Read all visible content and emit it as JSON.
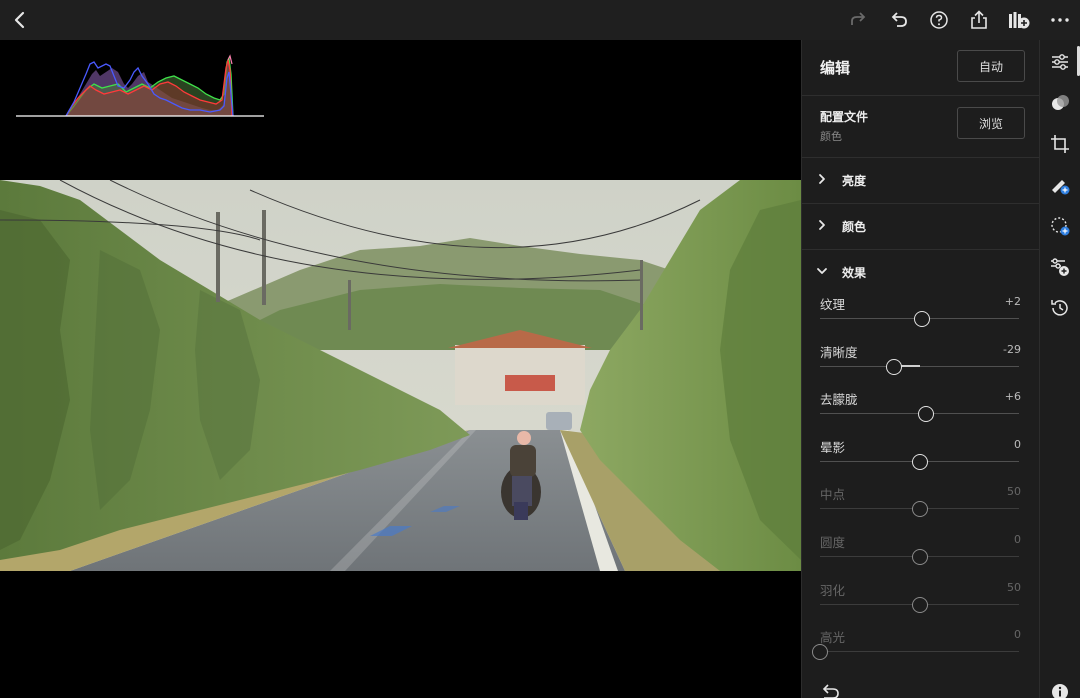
{
  "toolbar": {
    "back_icon": "chevron-left-icon",
    "redo_icon": "redo-icon",
    "undo_icon": "undo-icon",
    "help_icon": "help-circle-icon",
    "share_icon": "share-icon",
    "add_to_album_icon": "add-to-album-icon",
    "more_icon": "more-horizontal-icon"
  },
  "panel": {
    "title": "编辑",
    "auto_label": "自动",
    "profile": {
      "label": "配置文件",
      "value": "颜色",
      "browse_label": "浏览"
    },
    "sections": [
      {
        "name": "亮度",
        "expanded": false
      },
      {
        "name": "颜色",
        "expanded": false
      }
    ],
    "effects": {
      "name": "效果",
      "expanded": true,
      "sliders": [
        {
          "label": "纹理",
          "value": "+2",
          "pos": 0.51,
          "enabled": true
        },
        {
          "label": "清晰度",
          "value": "-29",
          "pos": 0.37,
          "enabled": true
        },
        {
          "label": "去朦胧",
          "value": "+6",
          "pos": 0.53,
          "enabled": true
        },
        {
          "label": "晕影",
          "value": "0",
          "pos": 0.5,
          "enabled": true
        },
        {
          "label": "中点",
          "value": "50",
          "pos": 0.5,
          "enabled": false
        },
        {
          "label": "圆度",
          "value": "0",
          "pos": 0.5,
          "enabled": false
        },
        {
          "label": "羽化",
          "value": "50",
          "pos": 0.5,
          "enabled": false
        },
        {
          "label": "高光",
          "value": "0",
          "pos": 0.0,
          "enabled": false
        }
      ]
    },
    "reset_icon": "reset-icon"
  },
  "rail": {
    "tools": [
      "edit-sliders-icon",
      "presets-icon",
      "crop-icon",
      "healing-icon",
      "masking-icon",
      "versions-icon",
      "history-icon"
    ],
    "info_icon": "info-icon"
  },
  "colors": {
    "panel_bg": "#1d1d1d",
    "toolbar_bg": "#1f1f1f",
    "accent_blue": "#2f7fe0"
  }
}
